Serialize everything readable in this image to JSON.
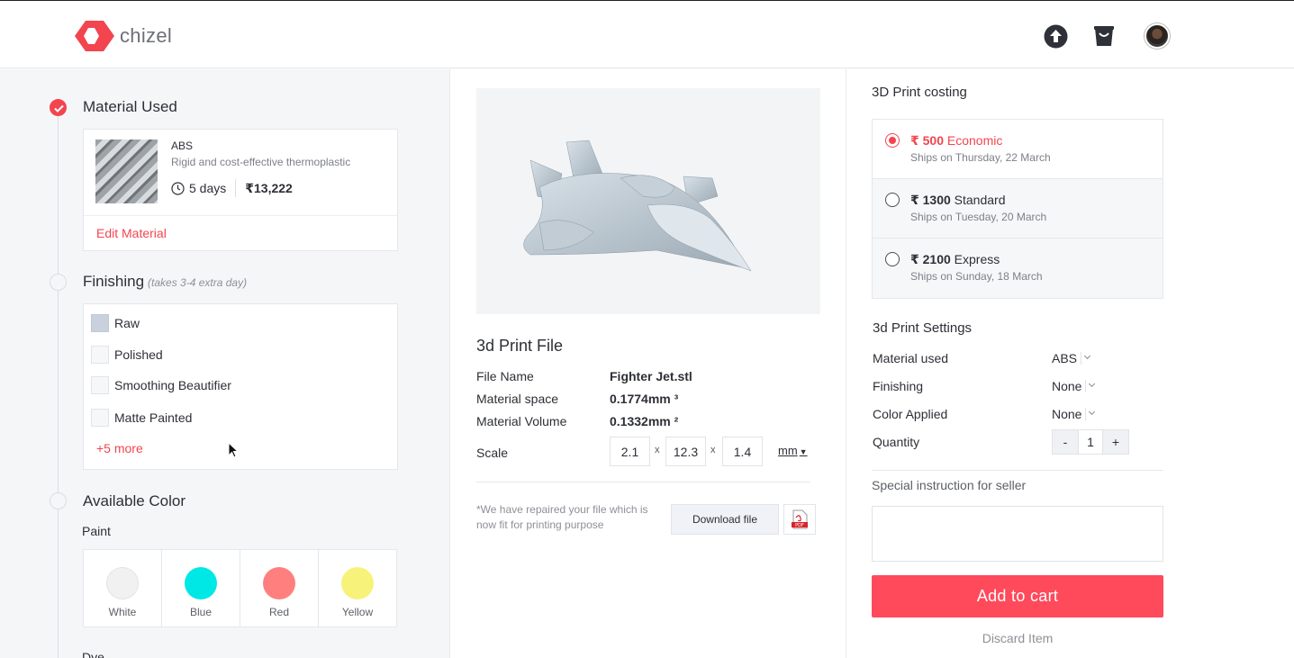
{
  "header": {
    "logo_text": "chizel",
    "brand_color": "#f2454f",
    "icons": [
      "upload-icon",
      "cart-icon",
      "avatar"
    ]
  },
  "material": {
    "title": "Material Used",
    "name": "ABS",
    "description": "Rigid and cost-effective thermoplastic",
    "days": "5 days",
    "price": "₹13,222",
    "edit_label": "Edit Material"
  },
  "finishing": {
    "title": "Finishing",
    "hint": "(takes 3-4 extra day)",
    "items": [
      {
        "label": "Raw",
        "checked": true
      },
      {
        "label": "Polished",
        "checked": false
      },
      {
        "label": "Smoothing Beautifier",
        "checked": false
      },
      {
        "label": "Matte Painted",
        "checked": false
      }
    ],
    "more_label": "+5 more"
  },
  "color": {
    "title": "Available Color",
    "paint_label": "Paint",
    "swatches": [
      {
        "name": "White",
        "color": "#f1f1f2"
      },
      {
        "name": "Blue",
        "color": "#00e8e6"
      },
      {
        "name": "Red",
        "color": "#ff7f7f"
      },
      {
        "name": "Yellow",
        "color": "#f7f27a"
      }
    ],
    "dye_label": "Dye"
  },
  "file": {
    "title": "3d Print File",
    "rows": [
      {
        "label": "File Name",
        "value": "Fighter Jet.stl"
      },
      {
        "label": "Material space",
        "value": "0.1774mm ³"
      },
      {
        "label": "Material Volume",
        "value": "0.1332mm ²"
      }
    ],
    "scale_label": "Scale",
    "scale": [
      "2.1",
      "12.3",
      "1.4"
    ],
    "scale_sep": "x",
    "unit": "mm",
    "repair_note": "*We have repaired your file which is now fit for printing purpose",
    "download_label": "Download file",
    "pdf_label": "PDF"
  },
  "costing": {
    "title": "3D Print costing",
    "options": [
      {
        "price": "₹ 500",
        "tier": "Economic",
        "ship": "Ships on Thursday, 22 March",
        "selected": true
      },
      {
        "price": "₹ 1300",
        "tier": "Standard",
        "ship": "Ships on Tuesday, 20 March",
        "selected": false
      },
      {
        "price": "₹ 2100",
        "tier": "Express",
        "ship": "Ships on Sunday, 18 March",
        "selected": false
      }
    ]
  },
  "settings": {
    "title": "3d Print Settings",
    "rows": [
      {
        "label": "Material used",
        "value": "ABS"
      },
      {
        "label": "Finishing",
        "value": "None"
      },
      {
        "label": "Color Applied",
        "value": "None"
      }
    ],
    "quantity_label": "Quantity",
    "quantity": "1",
    "minus": "-",
    "plus": "+",
    "special_label": "Special instruction for seller",
    "cart_label": "Add to cart",
    "discard_label": "Discard Item"
  }
}
